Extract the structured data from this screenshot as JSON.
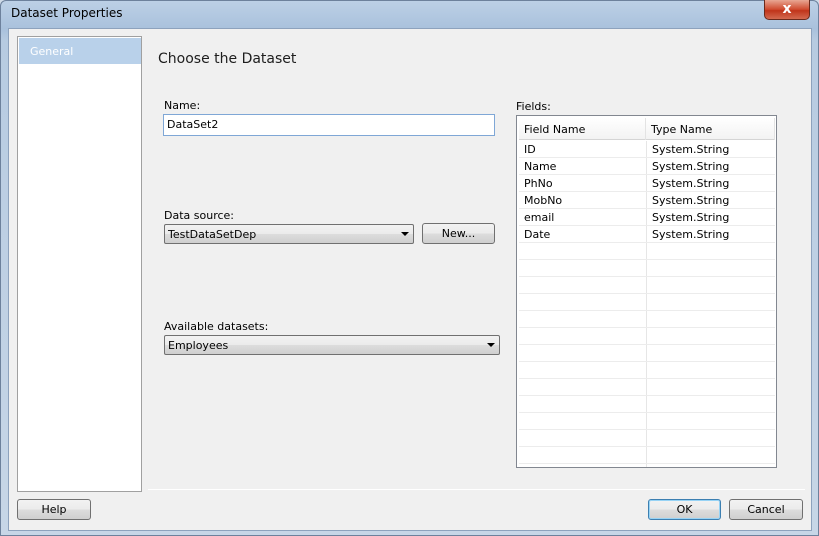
{
  "window": {
    "title": "Dataset Properties",
    "close_glyph": "x"
  },
  "nav": {
    "items": [
      {
        "label": "General",
        "selected": true
      }
    ]
  },
  "main": {
    "heading": "Choose the Dataset",
    "name_label": "Name:",
    "name_value": "DataSet2",
    "data_source_label": "Data source:",
    "data_source_value": "TestDataSetDep",
    "new_button": "New...",
    "available_datasets_label": "Available datasets:",
    "available_datasets_value": "Employees"
  },
  "fields": {
    "label": "Fields:",
    "columns": [
      "Field Name",
      "Type Name"
    ],
    "rows": [
      {
        "name": "ID",
        "type": "System.String"
      },
      {
        "name": "Name",
        "type": "System.String"
      },
      {
        "name": "PhNo",
        "type": "System.String"
      },
      {
        "name": "MobNo",
        "type": "System.String"
      },
      {
        "name": "email",
        "type": "System.String"
      },
      {
        "name": "Date",
        "type": "System.String"
      }
    ]
  },
  "footer": {
    "help": "Help",
    "ok": "OK",
    "cancel": "Cancel"
  }
}
